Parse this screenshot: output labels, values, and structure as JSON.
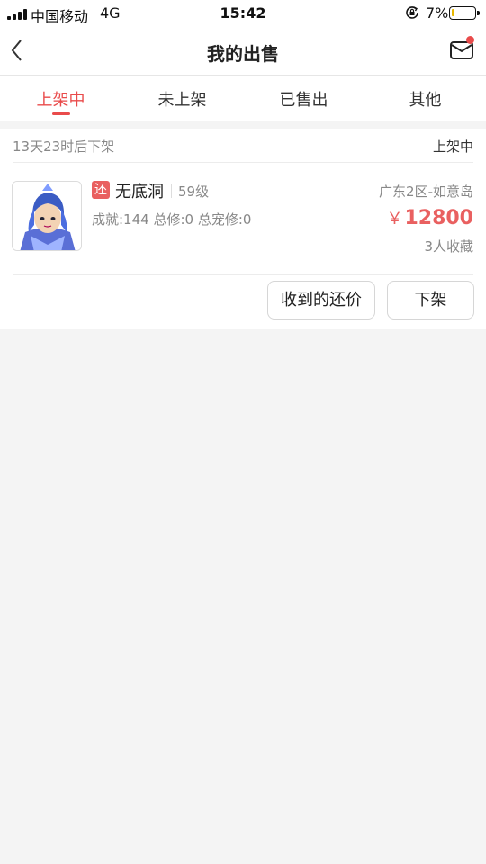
{
  "status_bar": {
    "carrier": "中国移动",
    "network": "4G",
    "time": "15:42",
    "battery_percent": "7%",
    "battery_level": 0.07
  },
  "nav": {
    "title": "我的出售",
    "back_icon": "chevron-left-icon",
    "mail_icon": "mail-icon",
    "mail_has_notification": true
  },
  "tabs": [
    {
      "label": "上架中",
      "active": true
    },
    {
      "label": "未上架",
      "active": false
    },
    {
      "label": "已售出",
      "active": false
    },
    {
      "label": "其他",
      "active": false
    }
  ],
  "listing": {
    "countdown": "13天23时后下架",
    "status": "上架中",
    "badge": "还",
    "name": "无底洞",
    "level": "59级",
    "stats": "成就:144 总修:0 总宠修:0",
    "server": "广东2区-如意岛",
    "price_symbol": "￥",
    "price": "12800",
    "favorites": "3人收藏",
    "actions": {
      "offers": "收到的还价",
      "delist": "下架"
    }
  },
  "colors": {
    "accent": "#e94b4b",
    "price": "#e96060",
    "background": "#f4f4f4"
  }
}
